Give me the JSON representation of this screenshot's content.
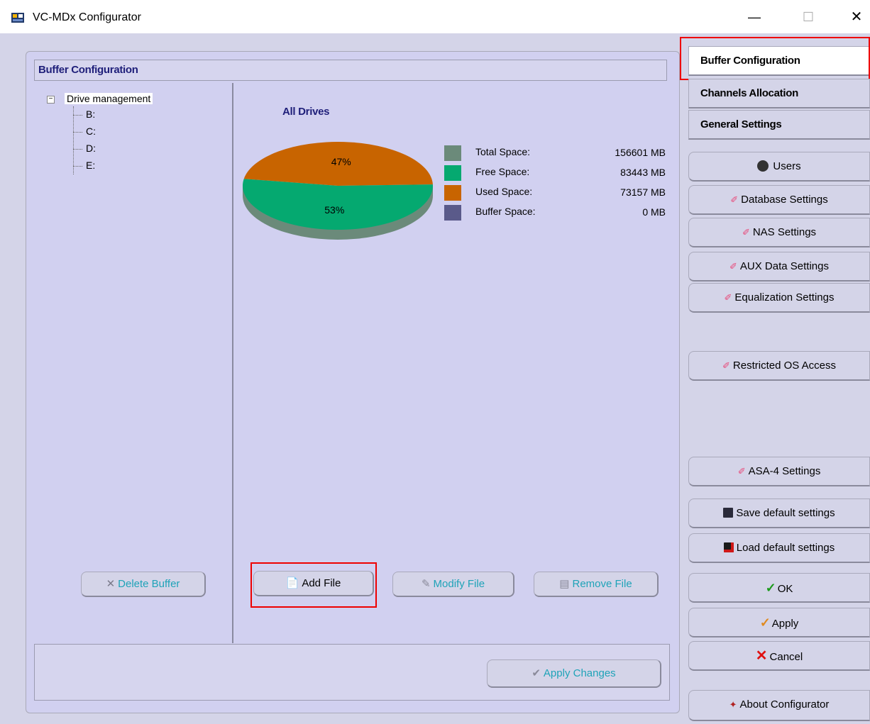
{
  "window": {
    "title": "VC-MDx Configurator",
    "minimize": "—",
    "maximize": "☐",
    "close": "✕"
  },
  "section": {
    "title": "Buffer Configuration"
  },
  "tree": {
    "root": "Drive management",
    "expander": "−",
    "items": [
      "B:",
      "C:",
      "D:",
      "E:"
    ]
  },
  "chart_data": {
    "type": "pie",
    "title": "All Drives",
    "slices": [
      {
        "label": "Used Space",
        "value": 47,
        "display": "47%",
        "color": "#c86400"
      },
      {
        "label": "Free Space",
        "value": 53,
        "display": "53%",
        "color": "#05a970"
      }
    ],
    "legend": [
      {
        "label": "Total Space:",
        "value": "156601 MB",
        "color": "#6b8a7a"
      },
      {
        "label": "Free Space:",
        "value": "83443 MB",
        "color": "#05a970"
      },
      {
        "label": "Used Space:",
        "value": "73157 MB",
        "color": "#c86400"
      },
      {
        "label": "Buffer Space:",
        "value": "0 MB",
        "color": "#5a5a8a"
      }
    ],
    "legend_position": "right"
  },
  "buttons": {
    "delete_buffer": "Delete Buffer",
    "add_file": "Add File",
    "modify_file": "Modify File",
    "remove_file": "Remove File",
    "apply_changes": "Apply Changes"
  },
  "sidebar": {
    "tabs": [
      "Buffer Configuration",
      "Channels Allocation",
      "General Settings"
    ],
    "users": "Users",
    "database_settings": "Database Settings",
    "nas_settings": "NAS Settings",
    "aux_data_settings": "AUX Data Settings",
    "equalization_settings": "Equalization Settings",
    "restricted_os_access": "Restricted OS Access",
    "asa4_settings": "ASA-4 Settings",
    "save_default": "Save default settings",
    "load_default": "Load default settings",
    "ok": "OK",
    "apply": "Apply",
    "cancel": "Cancel",
    "about": "About  Configurator"
  }
}
